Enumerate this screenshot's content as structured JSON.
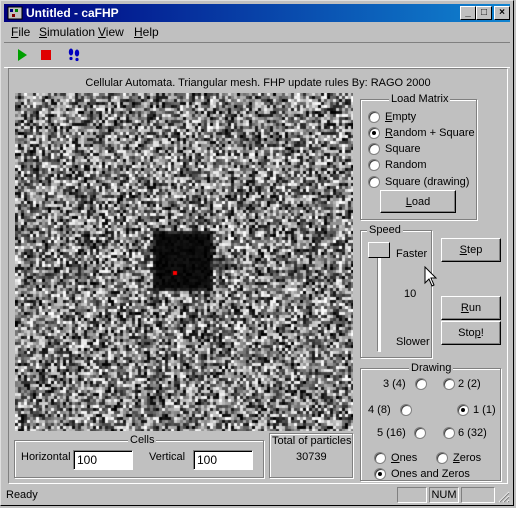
{
  "window": {
    "title": "Untitled - caFHP",
    "title_buttons": [
      "_",
      "□",
      "×"
    ]
  },
  "menu": {
    "items": [
      {
        "key": "F",
        "rest": "ile"
      },
      {
        "key": "S",
        "rest": "imulation"
      },
      {
        "key": "V",
        "rest": "iew"
      },
      {
        "key": "H",
        "rest": "elp"
      }
    ]
  },
  "toolbar": {
    "buttons": [
      "play-icon",
      "stop-icon",
      "footprints-icon"
    ],
    "colors": {
      "play": "#00a000",
      "stop": "#e00000",
      "footprints": "#0000c0"
    }
  },
  "header": {
    "subtitle": "Cellular Automata. Triangular mesh.  FHP update rules  By: RAGO 2000"
  },
  "load_matrix": {
    "title": "Load Matrix",
    "options": [
      {
        "key": "E",
        "rest": "mpty",
        "selected": false
      },
      {
        "key": "R",
        "rest": "andom + Square",
        "selected": true
      },
      {
        "key": "",
        "rest": "Square",
        "selected": false
      },
      {
        "key": "",
        "rest": "Random",
        "selected": false
      },
      {
        "key": "",
        "rest": "Square (drawing)",
        "selected": false
      }
    ],
    "load_key": "L",
    "load_rest": "oad"
  },
  "speed": {
    "title": "Speed",
    "faster": "Faster",
    "value": "10",
    "slower": "Slower",
    "level": 1.0
  },
  "buttons": {
    "step_key": "S",
    "step_rest": "tep",
    "run_key": "R",
    "run_rest": "un",
    "stop_pre": "Sto",
    "stop_key": "p",
    "stop_rest": "!"
  },
  "drawing": {
    "title": "Drawing",
    "dir_3": "3 (4)",
    "dir_2": "2 (2)",
    "dir_4": "4 (8)",
    "dir_1": "1 (1)",
    "dir_5": "5 (16)",
    "dir_6": "6 (32)",
    "selected": "1 (1)",
    "ones_key": "O",
    "ones_rest": "nes",
    "zeros_key": "Z",
    "zeros_rest": "eros",
    "onesz_pre": "Ones and Zeros"
  },
  "cells": {
    "title": "Cells",
    "horizontal_label": "Horizontal",
    "horizontal_value": "100",
    "vertical_label": "Vertical",
    "vertical_value": "100"
  },
  "total": {
    "label": "Total of particles",
    "value": "30739"
  },
  "status": {
    "text": "Ready",
    "num": "NUM"
  }
}
